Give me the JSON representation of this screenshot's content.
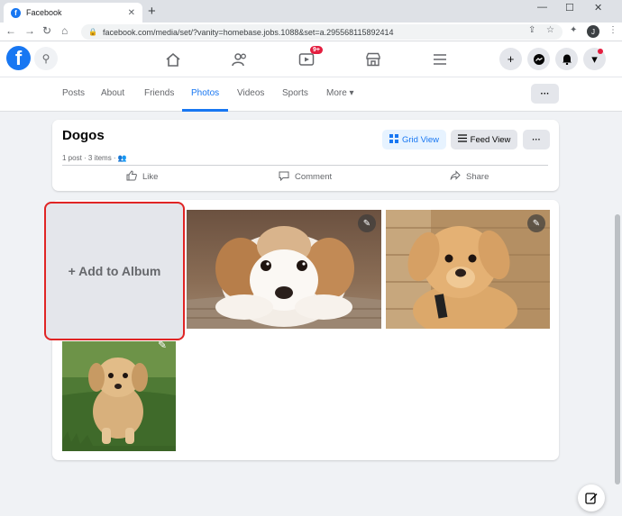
{
  "browser": {
    "tab_title": "Facebook",
    "tab_favicon": "f",
    "tab_close": "✕",
    "new_tab": "+",
    "url": "facebook.com/media/set/?vanity=homebase.jobs.1088&set=a.295568115892414",
    "profile_initial": "J",
    "window_controls": [
      "—",
      "☐",
      "✕"
    ]
  },
  "fb_nav": {
    "logo": "f",
    "video_badge": "9+",
    "icons": [
      "home-icon",
      "friends-icon",
      "watch-icon",
      "marketplace-icon",
      "menu-icon"
    ],
    "right_buttons": [
      "+",
      "◍",
      "♦",
      "▾"
    ]
  },
  "profile_tabs": {
    "items": [
      "Posts",
      "About",
      "Friends",
      "Photos",
      "Videos",
      "Sports",
      "More ▾"
    ],
    "active": "Photos",
    "more_button": "···"
  },
  "album": {
    "title": "Dogos",
    "meta": "1 post · 3 items · 👥",
    "grid_view_label": "Grid View",
    "feed_view_label": "Feed View",
    "more_label": "···",
    "like_label": "Like",
    "comment_label": "Comment",
    "share_label": "Share"
  },
  "photos": {
    "add_to_album_label": "+ Add to Album",
    "items": [
      {
        "name": "fluffy-puppy-lying-down"
      },
      {
        "name": "labrador-puppy-sitting"
      },
      {
        "name": "golden-puppy-running-grass"
      }
    ]
  },
  "colors": {
    "accent": "#1877f2",
    "highlight_border": "#e02424",
    "badge": "#e41e3f"
  }
}
